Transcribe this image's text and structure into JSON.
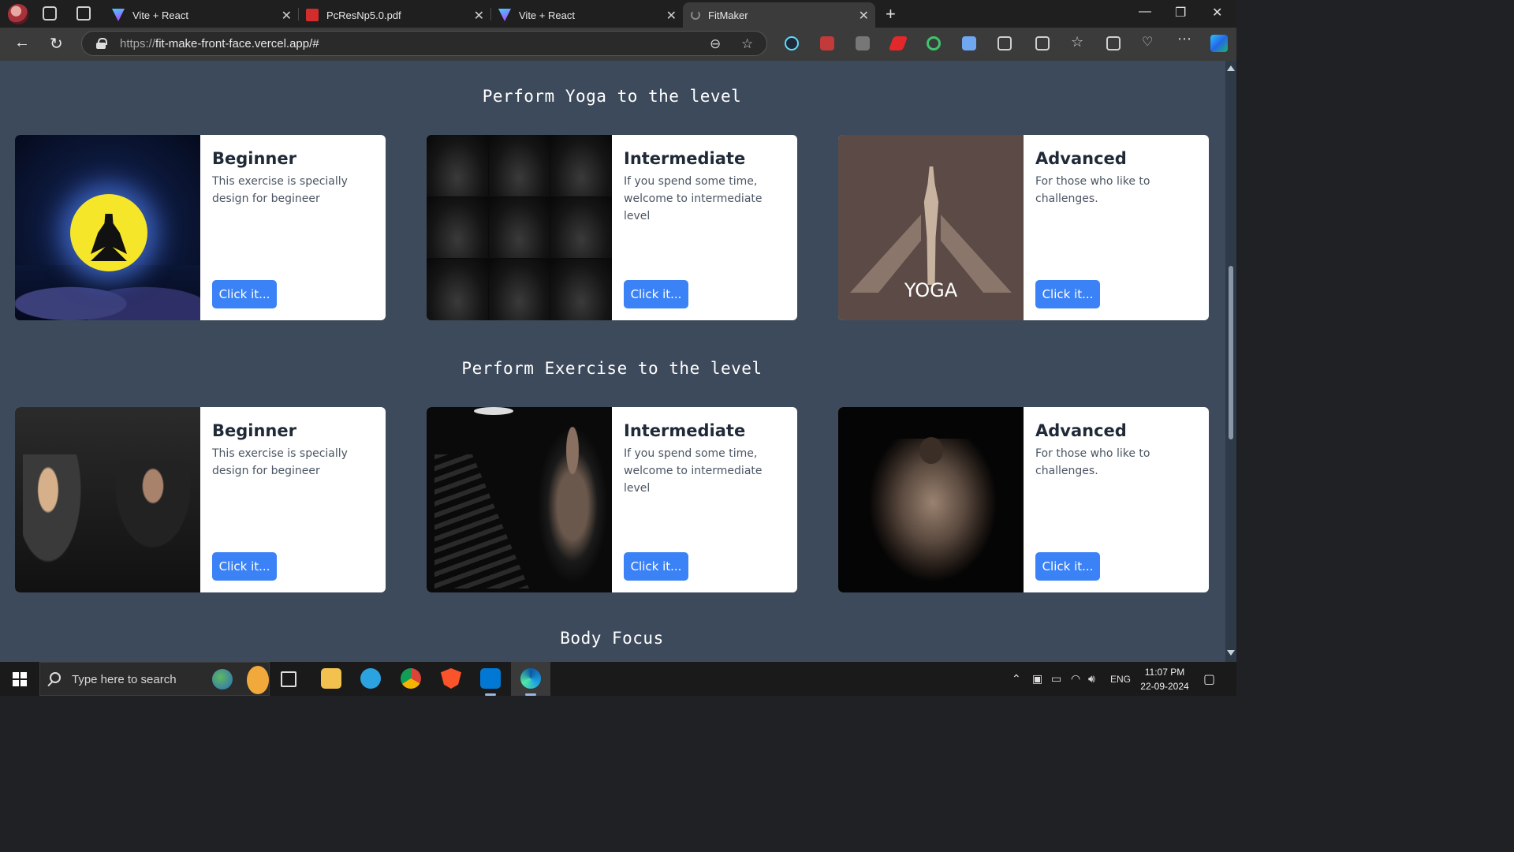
{
  "browser": {
    "tabs": [
      {
        "title": "Vite + React",
        "favicon": "vite-icon"
      },
      {
        "title": "PcResNp5.0.pdf",
        "favicon": "pdf-icon"
      },
      {
        "title": "Vite + React",
        "favicon": "vite-icon"
      },
      {
        "title": "FitMaker",
        "favicon": "loading-icon",
        "active": true
      }
    ],
    "close_glyph": "✕",
    "new_tab_glyph": "+",
    "url_scheme": "https://",
    "url_host": "fit-make-front-face.vercel.app/#",
    "window_controls": {
      "minimize": "—",
      "restore": "❐",
      "close": "✕"
    }
  },
  "page": {
    "colors": {
      "background": "#3d4a5b",
      "card": "#ffffff",
      "button": "#3b82f6"
    },
    "sections": [
      {
        "title": "Perform Yoga to the level",
        "cards": [
          {
            "title": "Beginner",
            "text": "This exercise is specially design for begineer",
            "button": "Click it...",
            "image": "meditation-moon-image"
          },
          {
            "title": "Intermediate",
            "text": "If you spend some time, welcome to intermediate level",
            "button": "Click it...",
            "image": "yoga-poses-grid-image"
          },
          {
            "title": "Advanced",
            "text": "For those who like to challenges.",
            "button": "Click it...",
            "image": "yoga-poster-image",
            "image_caption": "YOGA"
          }
        ]
      },
      {
        "title": "Perform Exercise to the level",
        "cards": [
          {
            "title": "Beginner",
            "text": "This exercise is specially design for begineer",
            "button": "Click it...",
            "image": "pushup-couple-image"
          },
          {
            "title": "Intermediate",
            "text": "If you spend some time, welcome to intermediate level",
            "button": "Click it...",
            "image": "gym-dumbbells-image"
          },
          {
            "title": "Advanced",
            "text": "For those who like to challenges.",
            "button": "Click it...",
            "image": "muscular-back-image"
          }
        ]
      },
      {
        "title": "Body Focus",
        "cards": []
      }
    ]
  },
  "taskbar": {
    "search_placeholder": "Type here to search",
    "apps": [
      "task-view-icon",
      "file-explorer-icon",
      "telegram-icon",
      "chrome-icon",
      "brave-icon",
      "vscode-icon",
      "edge-icon"
    ],
    "language": "ENG",
    "time": "11:07 PM",
    "date": "22-09-2024"
  }
}
